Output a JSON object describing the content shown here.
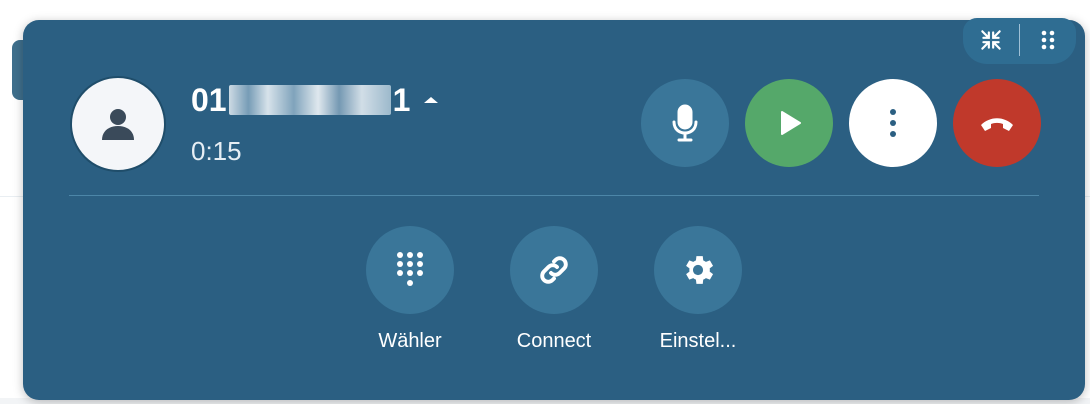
{
  "call": {
    "number_prefix": "01",
    "number_suffix": "1",
    "timer": "0:15"
  },
  "controls": {
    "mute_icon": "microphone-icon",
    "resume_icon": "play-icon",
    "more_icon": "more-vertical-icon",
    "hangup_icon": "hangup-icon"
  },
  "actions": [
    {
      "label": "Wähler",
      "icon": "dialpad-icon"
    },
    {
      "label": "Connect",
      "icon": "link-icon"
    },
    {
      "label": "Einstel...",
      "icon": "gear-icon"
    }
  ],
  "colors": {
    "panel": "#2b5f82",
    "resume": "#55a86a",
    "hangup": "#c0392b",
    "button": "#3a7699"
  }
}
